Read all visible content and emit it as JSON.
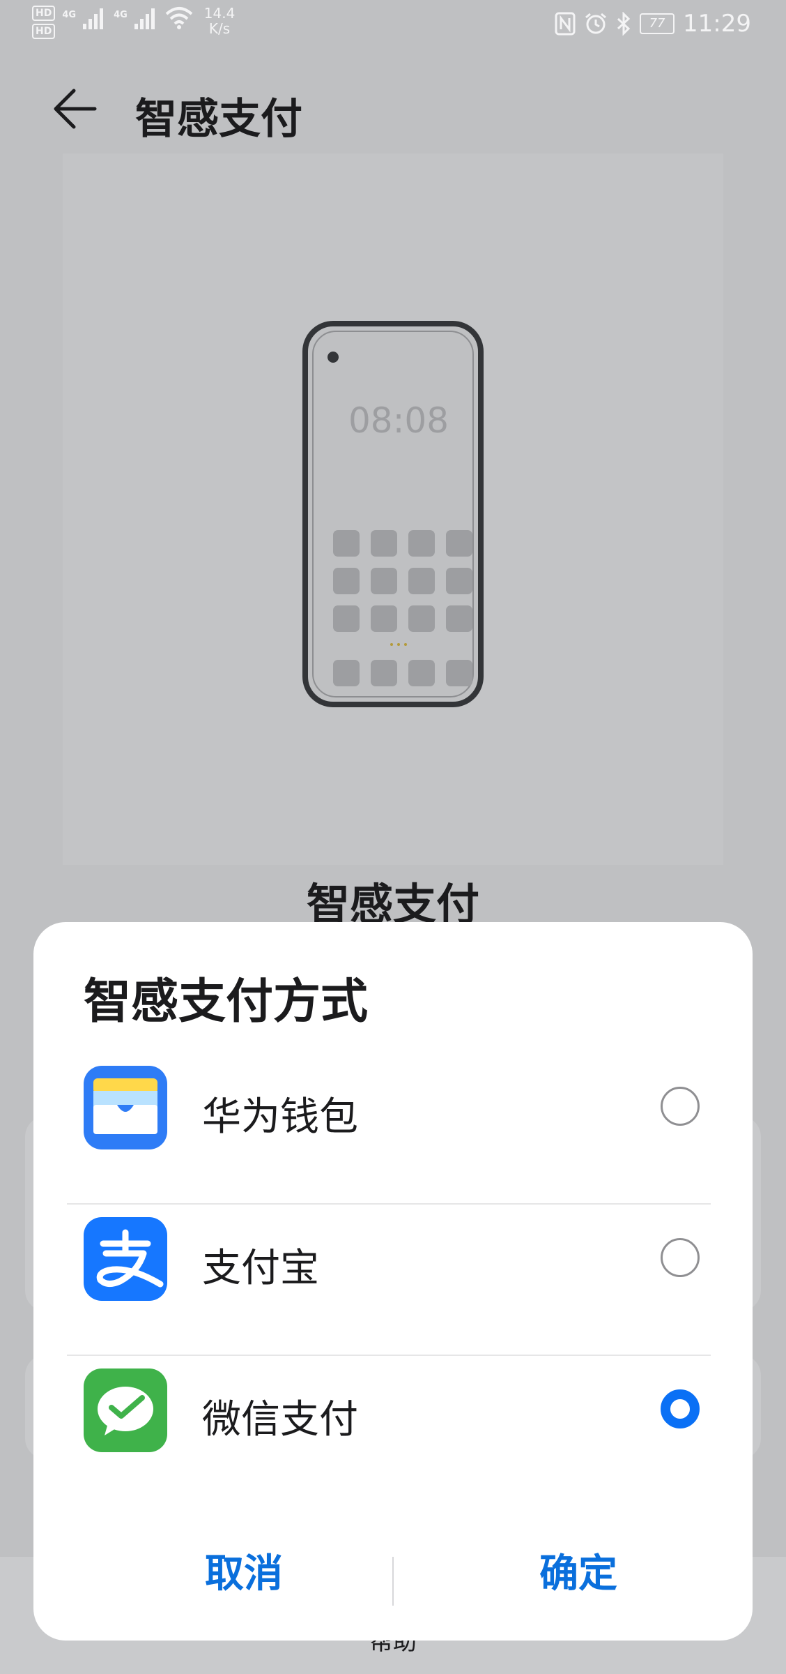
{
  "status_bar": {
    "hd1": "HD",
    "hd2": "HD",
    "net1": "4G",
    "net2": "4G",
    "speed_value": "14.4",
    "speed_unit": "K/s",
    "battery": "77",
    "time": "11:29"
  },
  "header": {
    "title": "智感支付"
  },
  "hero": {
    "phone_time": "08:08",
    "title": "智感支付"
  },
  "footer": {
    "help": "帮助"
  },
  "dialog": {
    "title": "智感支付方式",
    "options": [
      {
        "label": "华为钱包",
        "icon": "huawei-wallet-icon",
        "selected": false
      },
      {
        "label": "支付宝",
        "icon": "alipay-icon",
        "selected": false
      },
      {
        "label": "微信支付",
        "icon": "wechat-pay-icon",
        "selected": true
      }
    ],
    "cancel_label": "取消",
    "confirm_label": "确定"
  },
  "colors": {
    "accent": "#0a70f5",
    "button_text": "#0a6fdc",
    "wallet_blue": "#2e7cf6",
    "alipay_blue": "#1677ff",
    "wechat_green": "#3fb24a"
  }
}
